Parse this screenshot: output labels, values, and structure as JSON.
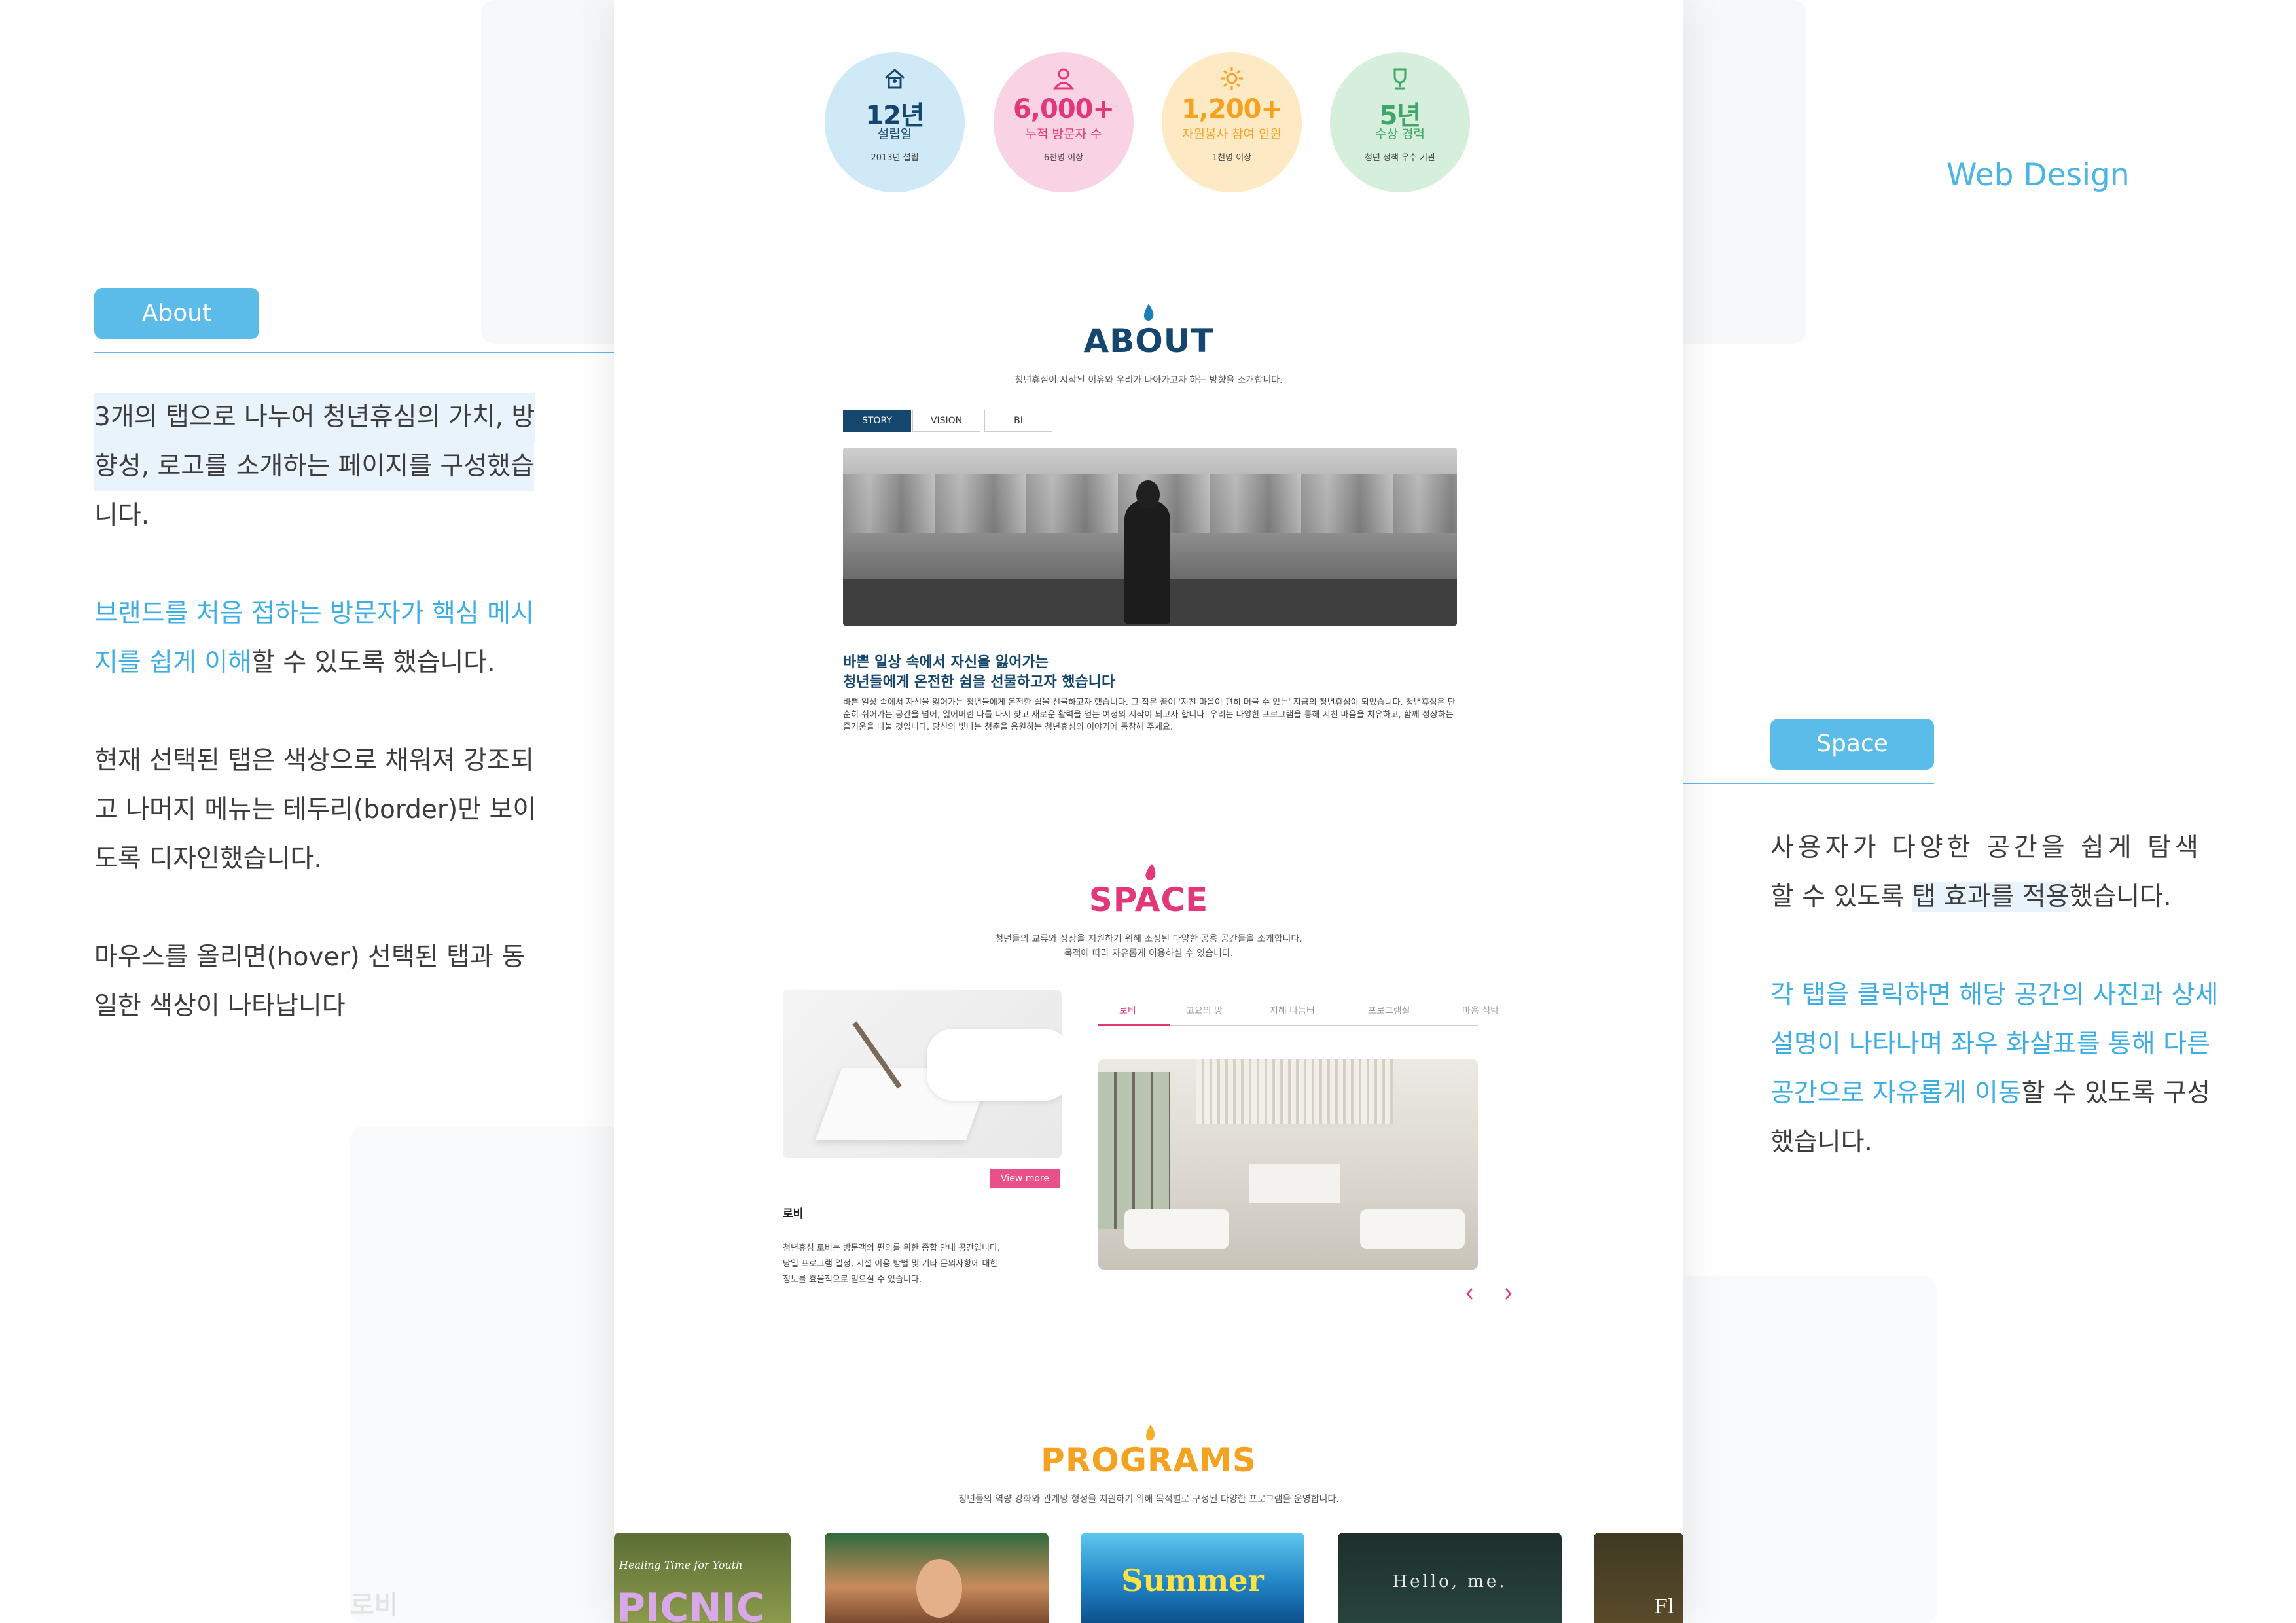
{
  "corner_label": "Web Design",
  "about_annotation": {
    "pill": "About",
    "p1_lines": [
      "3개의 탭으로 나누어 청년휴심의 가치, 방",
      "향성, 로고를 소개하는 페이지를 구성했습",
      "니다."
    ],
    "p2_line1": "브랜드를 처음 접하는 방문자가 핵심 메시",
    "p2_line2_blue": "지를 쉽게 이해",
    "p2_line2_rest": "할 수 있도록 했습니다.",
    "p3_lines": [
      "현재 선택된 탭은 색상으로 채워져 강조되",
      "고 나머지 메뉴는 테두리(border)만 보이",
      "도록 디자인했습니다."
    ],
    "p4_lines": [
      "마우스를 올리면(hover) 선택된 탭과 동",
      "일한 색상이 나타납니다"
    ]
  },
  "space_annotation": {
    "pill": "Space",
    "p1_line1": "사용자가 다양한 공간을 쉽게 탐색",
    "p1_line2_a": "할 수 있도록 ",
    "p1_line2_b": "탭 효과를 적용",
    "p1_line2_c": "했습니다.",
    "p2_blue1": "각 탭을 클릭하면 해당 공간의 사진과 상세",
    "p2_blue2": "설명이 나타나며 좌우 화살표를 통해 다른",
    "p2_blue3": "공간으로 자유롭게 이동",
    "p2_rest3": "할 수 있도록 구성",
    "p2_line4": "했습니다."
  },
  "stats": [
    {
      "num": "12년",
      "label": "설립일",
      "sub": "2013년 설립",
      "icon": "house-icon",
      "bg": "#cfe9f6",
      "color": "#15466e"
    },
    {
      "num": "6,000+",
      "label": "누적 방문자 수",
      "sub": "6천명 이상",
      "icon": "person-icon",
      "bg": "#f9d3e3",
      "color": "#e2387a"
    },
    {
      "num": "1,200+",
      "label": "자원봉사 참여 인원",
      "sub": "1천명 이상",
      "icon": "sun-icon",
      "bg": "#fde9c3",
      "color": "#f4a21f"
    },
    {
      "num": "5년",
      "label": "수상 경력",
      "sub": "청년 정책 우수 기관",
      "icon": "trophy-icon",
      "bg": "#d6eedc",
      "color": "#3fa66a"
    }
  ],
  "about": {
    "title": "ABOUT",
    "subtitle": "청년휴심이 시작된 이유와 우리가 나아가고자 하는 방향을 소개합니다.",
    "tabs": [
      "STORY",
      "VISION",
      "BI"
    ],
    "heading1": "바쁜 일상 속에서 자신을 잃어가는",
    "heading2": "청년들에게 온전한 쉼을 선물하고자 했습니다",
    "body": "바쁜 일상 속에서 자신을 잃어가는 청년들에게 온전한 쉼을 선물하고자 했습니다. 그 작은 꿈이 '지친 마음이 편히 머물 수 있는' 지금의 청년휴심이 되었습니다. 청년휴심은 단순히 쉬어가는 공간을 넘어, 잃어버린 나를 다시 찾고 새로운 활력을 얻는 여정의 시작이 되고자 합니다. 우리는 다양한 프로그램을 통해 지친 마음을 치유하고, 함께 성장하는 즐거움을 나눌 것입니다. 당신의 빛나는 청춘을 응원하는 청년휴심의 이야기에 동참해 주세요."
  },
  "space": {
    "title": "SPACE",
    "subtitle1": "청년들의 교류와 성장을 지원하기 위해 조성된 다양한 공용 공간들을 소개합니다.",
    "subtitle2": "목적에 따라 자유롭게 이용하실 수 있습니다.",
    "view_more": "View more",
    "room_name": "로비",
    "room_desc": [
      "청년휴심 로비는 방문객의 편의를 위한 종합 안내 공간입니다.",
      "당일 프로그램 일정, 시설 이용 방법 및 기타 문의사항에 대한",
      "정보를 효율적으로 얻으실 수 있습니다."
    ],
    "tabs": [
      "로비",
      "고요의 방",
      "지혜 나눔터",
      "프로그램실",
      "마음 식탁"
    ]
  },
  "programs": {
    "title": "PROGRAMS",
    "subtitle": "청년들의 역량 강화와 관계망 형성을 지원하기 위해 목적별로 구성된 다양한 프로그램을 운영합니다.",
    "card_texts": [
      "Healing Time for Youth",
      "PICNIC",
      "Summer",
      "Hello, me.",
      "Fl"
    ]
  },
  "bottom_ghost": "로비",
  "colors": {
    "accent": "#5bbbe9",
    "navy": "#15466e",
    "pink": "#e2387a",
    "orange": "#f4a21f",
    "green": "#3fa66a"
  }
}
